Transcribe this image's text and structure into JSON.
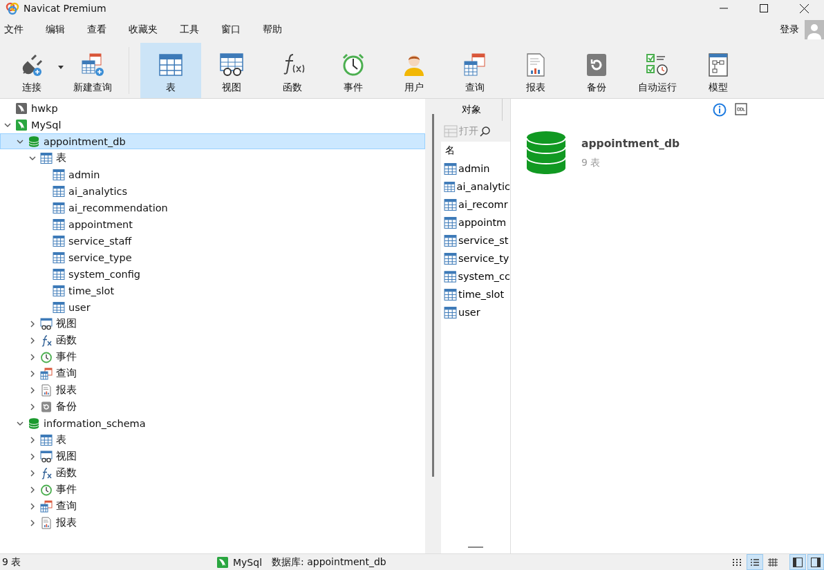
{
  "window": {
    "title": "Navicat Premium"
  },
  "menu": [
    "文件",
    "编辑",
    "查看",
    "收藏夹",
    "工具",
    "窗口",
    "帮助"
  ],
  "account": {
    "label": "登录"
  },
  "toolbar": [
    {
      "label": "连接",
      "kind": "connect",
      "selected": false,
      "has_menu": true
    },
    {
      "label": "新建查询",
      "kind": "newquery",
      "selected": false
    },
    {
      "label": "表",
      "kind": "table",
      "selected": true
    },
    {
      "label": "视图",
      "kind": "view",
      "selected": false
    },
    {
      "label": "函数",
      "kind": "function",
      "selected": false
    },
    {
      "label": "事件",
      "kind": "event",
      "selected": false
    },
    {
      "label": "用户",
      "kind": "user",
      "selected": false
    },
    {
      "label": "查询",
      "kind": "query",
      "selected": false
    },
    {
      "label": "报表",
      "kind": "report",
      "selected": false
    },
    {
      "label": "备份",
      "kind": "backup",
      "selected": false
    },
    {
      "label": "自动运行",
      "kind": "automation",
      "selected": false
    },
    {
      "label": "模型",
      "kind": "model",
      "selected": false
    }
  ],
  "tree": [
    {
      "label": "hwkp",
      "kind": "server",
      "selected": false
    },
    {
      "label": "MySql",
      "kind": "mysql",
      "expanded": true,
      "selected": false,
      "children": [
        {
          "label": "appointment_db",
          "kind": "database",
          "expanded": true,
          "selected": true,
          "children": [
            {
              "label": "表",
              "kind": "table",
              "expanded": true,
              "selected": false,
              "children": [
                {
                  "label": "admin",
                  "kind": "table",
                  "selected": false
                },
                {
                  "label": "ai_analytics",
                  "kind": "table",
                  "selected": false
                },
                {
                  "label": "ai_recommendation",
                  "kind": "table",
                  "selected": false
                },
                {
                  "label": "appointment",
                  "kind": "table",
                  "selected": false
                },
                {
                  "label": "service_staff",
                  "kind": "table",
                  "selected": false
                },
                {
                  "label": "service_type",
                  "kind": "table",
                  "selected": false
                },
                {
                  "label": "system_config",
                  "kind": "table",
                  "selected": false
                },
                {
                  "label": "time_slot",
                  "kind": "table",
                  "selected": false
                },
                {
                  "label": "user",
                  "kind": "table",
                  "selected": false
                }
              ]
            },
            {
              "label": "视图",
              "kind": "view",
              "expanded": false,
              "selected": false
            },
            {
              "label": "函数",
              "kind": "function",
              "expanded": false,
              "selected": false
            },
            {
              "label": "事件",
              "kind": "event",
              "expanded": false,
              "selected": false
            },
            {
              "label": "查询",
              "kind": "query",
              "expanded": false,
              "selected": false
            },
            {
              "label": "报表",
              "kind": "report",
              "expanded": false,
              "selected": false
            },
            {
              "label": "备份",
              "kind": "backup",
              "expanded": false,
              "selected": false
            }
          ]
        },
        {
          "label": "information_schema",
          "kind": "database",
          "expanded": true,
          "selected": false,
          "children": [
            {
              "label": "表",
              "kind": "table",
              "expanded": false,
              "selected": false
            },
            {
              "label": "视图",
              "kind": "view",
              "expanded": false,
              "selected": false
            },
            {
              "label": "函数",
              "kind": "function",
              "expanded": false,
              "selected": false
            },
            {
              "label": "事件",
              "kind": "event",
              "expanded": false,
              "selected": false
            },
            {
              "label": "查询",
              "kind": "query",
              "expanded": false,
              "selected": false
            },
            {
              "label": "报表",
              "kind": "report",
              "expanded": false,
              "selected": false
            }
          ]
        }
      ]
    }
  ],
  "objects": {
    "tab": "对象",
    "open_button": {
      "label": "打开",
      "disabled": true
    },
    "column": "名",
    "items": [
      {
        "label": "admin",
        "selected": false
      },
      {
        "label": "ai_analytic",
        "selected": false
      },
      {
        "label": "ai_recomr",
        "selected": false
      },
      {
        "label": "appointm",
        "selected": false
      },
      {
        "label": "service_st",
        "selected": false
      },
      {
        "label": "service_ty",
        "selected": false
      },
      {
        "label": "system_cc",
        "selected": false
      },
      {
        "label": "time_slot",
        "selected": false
      },
      {
        "label": "user",
        "selected": false
      }
    ]
  },
  "details": {
    "name": "appointment_db",
    "count": "9 表"
  },
  "status_bar": {
    "count": "9 表",
    "connection": "MySql",
    "database": "数据库: appointment_db",
    "view_modes": [
      {
        "selected": false
      },
      {
        "selected": true
      },
      {
        "selected": false
      }
    ],
    "panes": [
      {
        "selected": true
      },
      {
        "selected": true
      }
    ]
  }
}
